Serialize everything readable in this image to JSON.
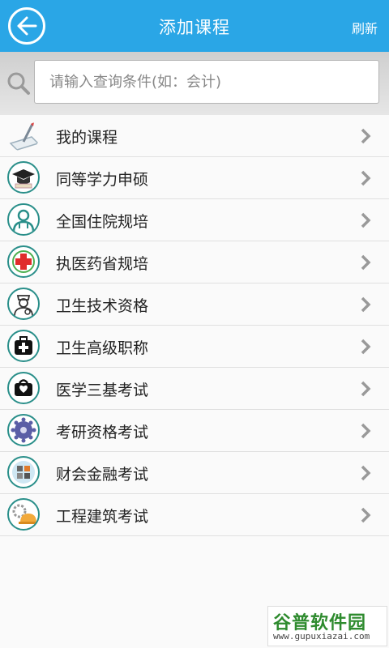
{
  "header": {
    "title": "添加课程",
    "refresh_label": "刷新",
    "accent_color": "#2aa6e6"
  },
  "search": {
    "placeholder": "请输入查询条件(如：会计)",
    "value": ""
  },
  "list": {
    "items": [
      {
        "label": "我的课程",
        "icon": "pen-paper-icon"
      },
      {
        "label": "同等学力申硕",
        "icon": "graduation-cap-icon"
      },
      {
        "label": "全国住院规培",
        "icon": "doctor-icon"
      },
      {
        "label": "执医药省规培",
        "icon": "red-cross-icon"
      },
      {
        "label": "卫生技术资格",
        "icon": "nurse-icon"
      },
      {
        "label": "卫生高级职称",
        "icon": "medical-kit-icon"
      },
      {
        "label": "医学三基考试",
        "icon": "first-aid-box-icon"
      },
      {
        "label": "考研资格考试",
        "icon": "gear-badge-icon"
      },
      {
        "label": "财会金融考试",
        "icon": "calculator-icon"
      },
      {
        "label": "工程建筑考试",
        "icon": "hard-hat-icon"
      }
    ]
  },
  "watermark": {
    "text": "谷普软件园",
    "url": "www.gupuxiazai.com"
  }
}
